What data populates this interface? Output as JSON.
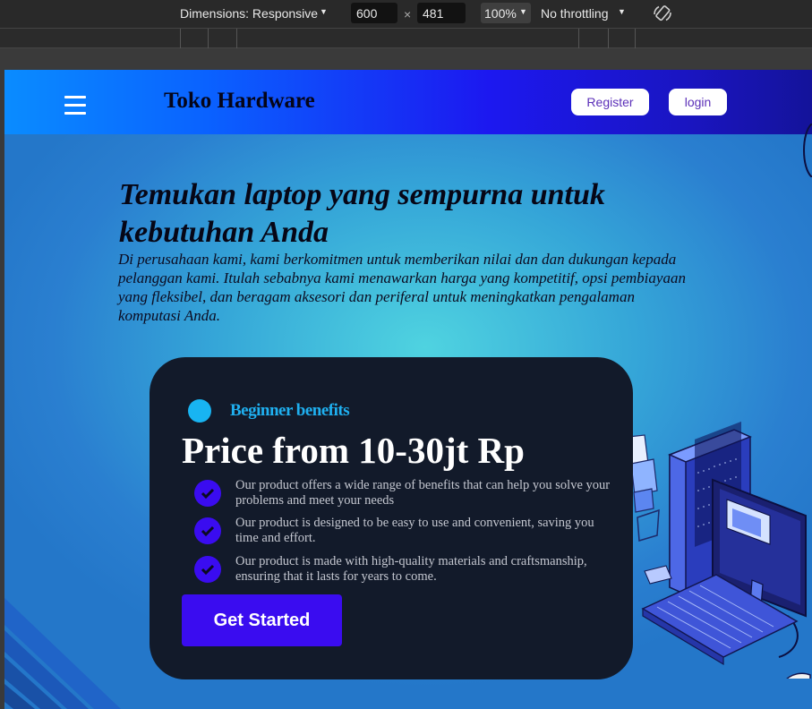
{
  "devtools": {
    "dimensions_label": "Dimensions: Responsive",
    "width_value": "600",
    "times_sign": "×",
    "height_value": "481",
    "zoom": "100%",
    "throttling": "No throttling"
  },
  "navbar": {
    "brand": "Toko Hardware",
    "register_label": "Register",
    "login_label": "login"
  },
  "hero": {
    "title": "Temukan laptop yang sempurna untuk kebutuhan Anda",
    "description": "Di perusahaan kami, kami berkomitmen untuk memberikan nilai dan dan dukungan kepada pelanggan kami. Itulah sebabnya kami menawarkan harga yang kompetitif, opsi pembiayaan yang fleksibel, dan beragam aksesori dan periferal untuk meningkatkan pengalaman komputasi Anda."
  },
  "card": {
    "badge": "Beginner benefits",
    "price": "Price from 10-30jt Rp",
    "features": [
      "Our product offers a wide range of benefits that can help you solve your problems and meet your needs",
      "Our product is designed to be easy to use and convenient, saving you time and effort.",
      "Our product is made with high-quality materials and craftsmanship, ensuring that it lasts for years to come."
    ],
    "cta": "Get Started"
  },
  "colors": {
    "navbar_start": "#0a8cff",
    "navbar_end": "#14139a",
    "card_bg": "#121a2a",
    "accent_purple": "#3a0cf0",
    "accent_cyan": "#1fb0f0"
  },
  "icons": [
    "menu-icon",
    "rotate-icon",
    "check-icon",
    "computer-illustration"
  ]
}
